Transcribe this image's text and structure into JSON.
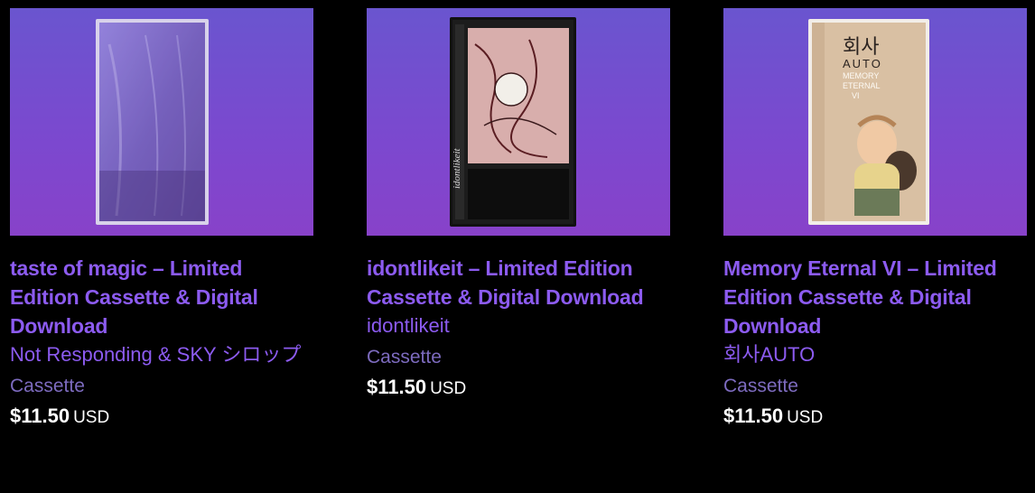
{
  "colors": {
    "page_background": "#000000",
    "accent": "#8c5bf0",
    "secondary_text": "#7d6bbf",
    "price_text": "#ffffff"
  },
  "products": [
    {
      "title": "taste of magic – Limited Edition Cassette & Digital Download",
      "artist": "Not Responding & SKY シロップ",
      "format": "Cassette",
      "price": "$11.50",
      "currency": "USD",
      "art_icon": "purple-cassette-cover"
    },
    {
      "title": "idontlikeit – Limited Edition Cassette & Digital Download",
      "artist": "idontlikeit",
      "format": "Cassette",
      "price": "$11.50",
      "currency": "USD",
      "art_icon": "black-cassette-cover",
      "art_text": "idontlikeit"
    },
    {
      "title": "Memory Eternal VI – Limited Edition Cassette & Digital Download",
      "artist": "회사AUTO",
      "format": "Cassette",
      "price": "$11.50",
      "currency": "USD",
      "art_icon": "beige-cassette-cover",
      "art_text_top": "회사",
      "art_text_auto": "AUTO",
      "art_text_sub1": "MEMORY",
      "art_text_sub2": "ETERNAL",
      "art_text_sub3": "VI"
    }
  ]
}
